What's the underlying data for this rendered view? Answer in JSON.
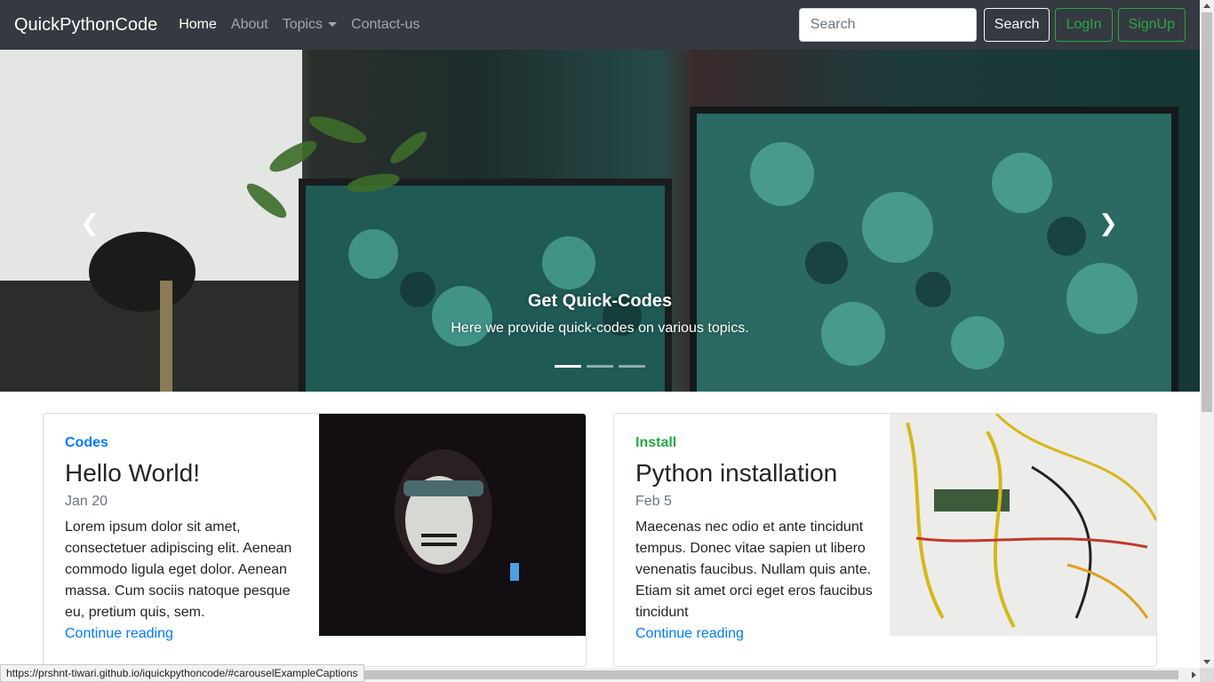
{
  "navbar": {
    "brand": "QuickPythonCode",
    "links": [
      {
        "label": "Home",
        "active": true
      },
      {
        "label": "About",
        "active": false
      },
      {
        "label": "Topics",
        "active": false,
        "dropdown": true
      },
      {
        "label": "Contact-us",
        "active": false
      }
    ],
    "search": {
      "placeholder": "Search",
      "button_label": "Search"
    },
    "login_label": "LogIn",
    "signup_label": "SignUp"
  },
  "carousel": {
    "caption_title": "Get Quick-Codes",
    "caption_text": "Here we provide quick-codes on various topics.",
    "indicators": 3,
    "active_index": 0,
    "prev_icon": "chevron-left-icon",
    "next_icon": "chevron-right-icon"
  },
  "cards": [
    {
      "category": "Codes",
      "category_color": "#007bff",
      "title": "Hello World!",
      "date": "Jan 20",
      "text": "Lorem ipsum dolor sit amet, consectetuer adipiscing elit. Aenean commodo ligula eget dolor. Aenean massa. Cum sociis natoque pesque eu, pretium quis, sem.",
      "link": "Continue reading"
    },
    {
      "category": "Install",
      "category_color": "#28a745",
      "title": "Python installation",
      "date": "Feb 5",
      "text": "Maecenas nec odio et ante tincidunt tempus. Donec vitae sapien ut libero venenatis faucibus. Nullam quis ante. Etiam sit amet orci eget eros faucibus tincidunt",
      "link": "Continue reading"
    }
  ],
  "status_bar": {
    "url": "https://prshnt-tiwari.github.io/iquickpythoncode/#carouselExampleCaptions"
  },
  "colors": {
    "navbar_bg": "#343a40",
    "primary": "#007bff",
    "success": "#28a745"
  }
}
